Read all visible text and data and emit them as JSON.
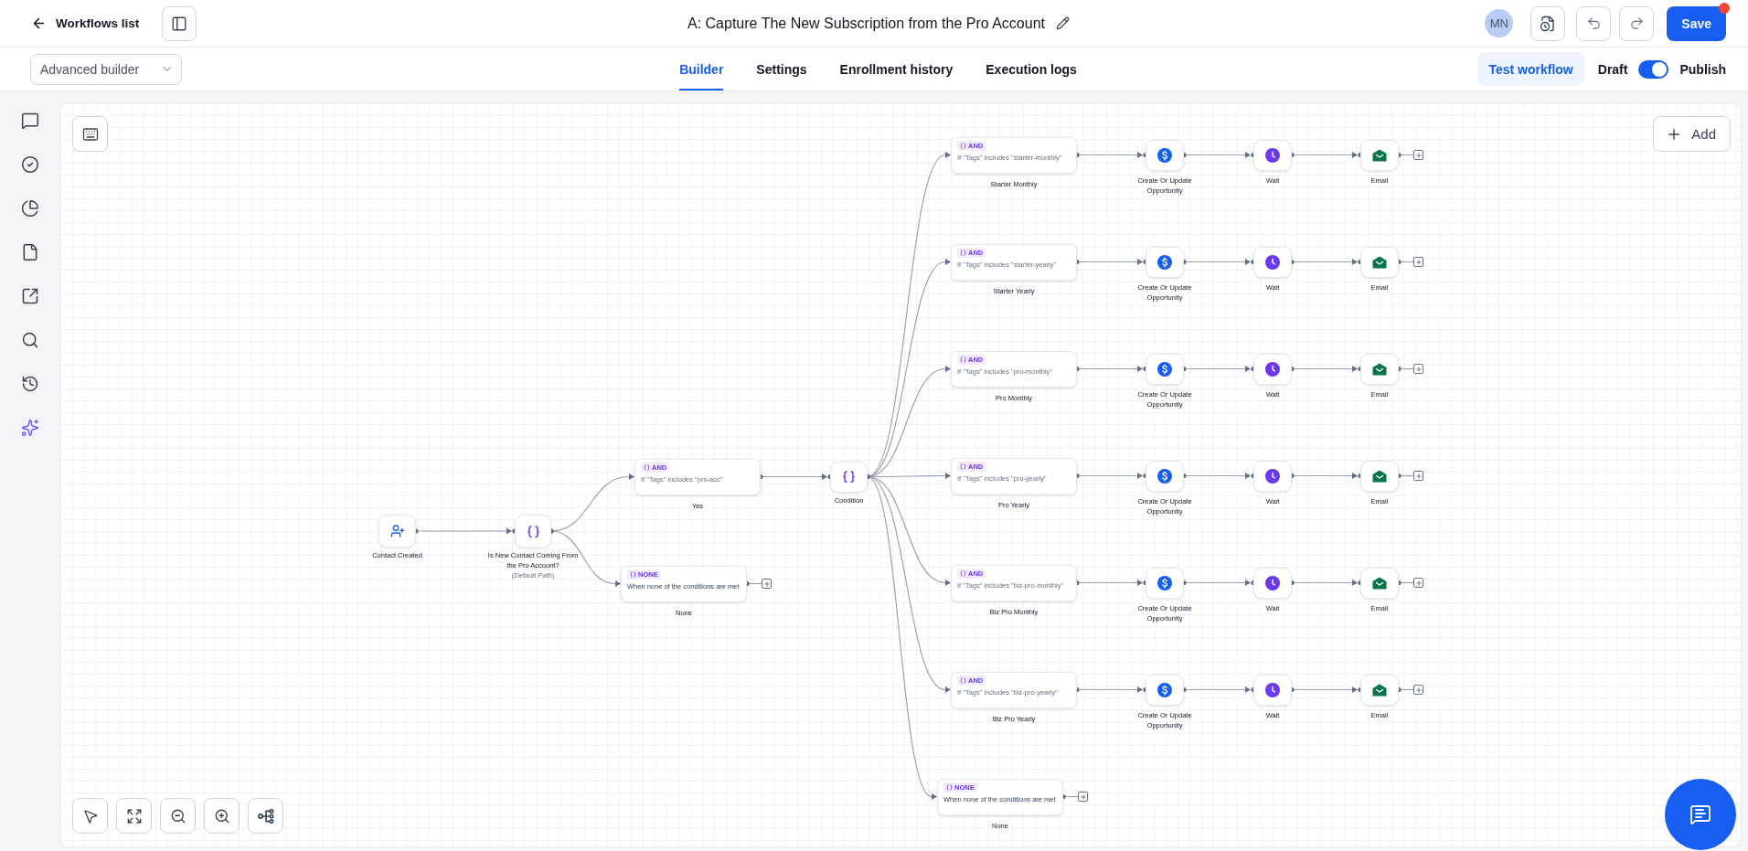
{
  "header": {
    "back_link": "Workflows list",
    "title": "A: Capture The New Subscription from the Pro Account",
    "avatar": "MN",
    "save_button": "Save"
  },
  "subnav": {
    "builder_mode": "Advanced builder",
    "tabs": [
      {
        "label": "Builder",
        "selected": true
      },
      {
        "label": "Settings",
        "selected": false
      },
      {
        "label": "Enrollment history",
        "selected": false
      },
      {
        "label": "Execution logs",
        "selected": false
      }
    ],
    "test_button": "Test workflow",
    "draft_label": "Draft",
    "publish_switch": {
      "on": true
    },
    "publish_label": "Publish"
  },
  "canvas": {
    "add_button": "Add",
    "trigger": {
      "label": "Contact Created"
    },
    "condition": {
      "label": "Is New Contact Coming From the Pro Account?",
      "note": "(Default Path)",
      "branches": [
        {
          "kind": "and",
          "operator": "AND",
          "rule": "If \"Tags\" includes \"pro-acc\"",
          "label": "Yes",
          "condition": {
            "label": "Condition",
            "branches": [
              {
                "kind": "and",
                "operator": "AND",
                "rule": "If \"Tags\" includes \"starter-monthly\"",
                "label": "Starter Monthly",
                "steps": [
                  {
                    "kind": "opportunity",
                    "label": "Create Or Update Opportunity"
                  },
                  {
                    "kind": "wait",
                    "label": "Wait"
                  },
                  {
                    "kind": "email",
                    "label": "Email"
                  }
                ]
              },
              {
                "kind": "and",
                "operator": "AND",
                "rule": "If \"Tags\" includes \"starter-yearly\"",
                "label": "Starter Yearly",
                "steps": [
                  {
                    "kind": "opportunity",
                    "label": "Create Or Update Opportunity"
                  },
                  {
                    "kind": "wait",
                    "label": "Wait"
                  },
                  {
                    "kind": "email",
                    "label": "Email"
                  }
                ]
              },
              {
                "kind": "and",
                "operator": "AND",
                "rule": "If \"Tags\" includes \"pro-monthly\"",
                "label": "Pro Monthly",
                "steps": [
                  {
                    "kind": "opportunity",
                    "label": "Create Or Update Opportunity"
                  },
                  {
                    "kind": "wait",
                    "label": "Wait"
                  },
                  {
                    "kind": "email",
                    "label": "Email"
                  }
                ]
              },
              {
                "kind": "and",
                "operator": "AND",
                "rule": "If \"Tags\" includes \"pro-yearly\"",
                "label": "Pro Yearly",
                "steps": [
                  {
                    "kind": "opportunity",
                    "label": "Create Or Update Opportunity"
                  },
                  {
                    "kind": "wait",
                    "label": "Wait"
                  },
                  {
                    "kind": "email",
                    "label": "Email"
                  }
                ]
              },
              {
                "kind": "and",
                "operator": "AND",
                "rule": "If \"Tags\" includes \"biz-pro-monthly\"",
                "label": "Biz Pro Monthly",
                "steps": [
                  {
                    "kind": "opportunity",
                    "label": "Create Or Update Opportunity"
                  },
                  {
                    "kind": "wait",
                    "label": "Wait"
                  },
                  {
                    "kind": "email",
                    "label": "Email"
                  }
                ]
              },
              {
                "kind": "and",
                "operator": "AND",
                "rule": "If \"Tags\" includes \"biz-pro-yearly\"",
                "label": "Biz Pro Yearly",
                "steps": [
                  {
                    "kind": "opportunity",
                    "label": "Create Or Update Opportunity"
                  },
                  {
                    "kind": "wait",
                    "label": "Wait"
                  },
                  {
                    "kind": "email",
                    "label": "Email"
                  }
                ]
              },
              {
                "kind": "none",
                "operator": "NONE",
                "rule": "When none of the conditions are met",
                "label": "None"
              }
            ]
          }
        },
        {
          "kind": "none",
          "operator": "NONE",
          "rule": "When none of the conditions are met",
          "label": "None"
        }
      ]
    }
  }
}
